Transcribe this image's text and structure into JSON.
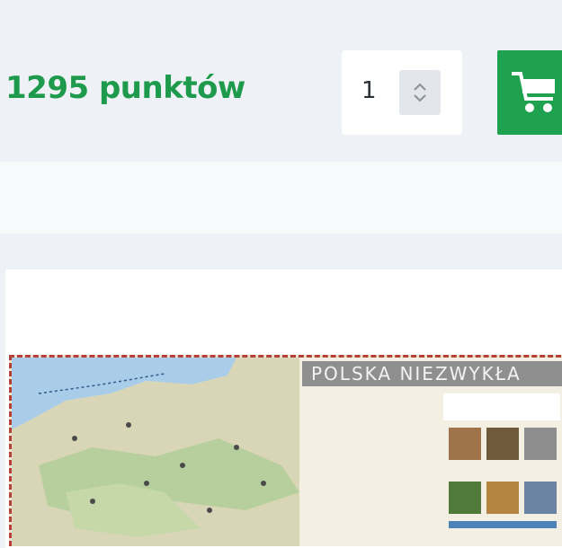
{
  "product": {
    "price_points": "1295 punktów",
    "quantity": "1"
  },
  "cart": {
    "icon": "shopping-cart-icon",
    "color": "#1ea24f"
  },
  "map_card": {
    "title": "POLSKA NIEZWYKŁA"
  },
  "colors": {
    "accent": "#1e9a4c",
    "background": "#eef1f5",
    "map_border": "#b5403a"
  }
}
